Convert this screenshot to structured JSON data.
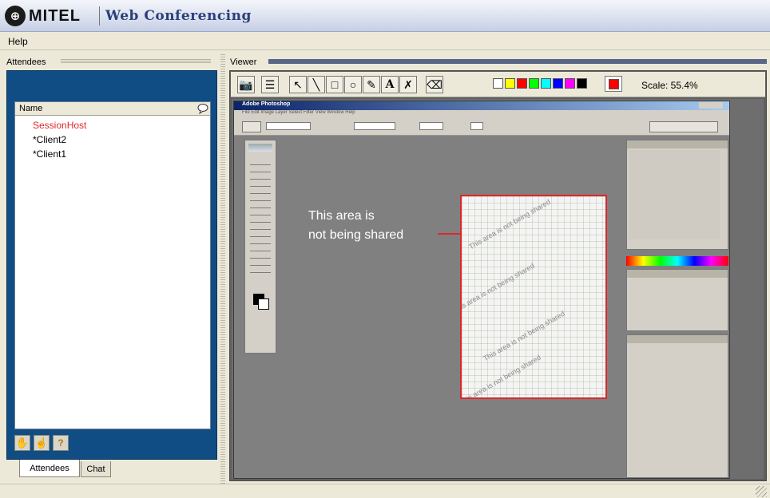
{
  "app": {
    "brand": "MITEL",
    "title": "Web Conferencing"
  },
  "menu": {
    "help": "Help"
  },
  "attendees_pane": {
    "title": "Attendees",
    "column_name": "Name",
    "list": [
      {
        "name": "SessionHost",
        "color": "#e0262b"
      },
      {
        "name": "*Client2",
        "color": "#000000"
      },
      {
        "name": "*Client1",
        "color": "#000000"
      }
    ],
    "tabs": [
      "Attendees",
      "Chat"
    ]
  },
  "viewer": {
    "title": "Viewer",
    "scale_text": "Scale: 55.4%",
    "palette": [
      "#ffffff",
      "#ffff00",
      "#ff0000",
      "#00ff00",
      "#00ffff",
      "#0000ff",
      "#ff00ff",
      "#000000"
    ],
    "active_color": "#ff0000",
    "tools": [
      "camera-icon",
      "line-weight-icon",
      "pointer-icon",
      "line-icon",
      "rectangle-icon",
      "ellipse-icon",
      "highlighter-icon",
      "text-icon",
      "eraser-icon",
      "clear-icon"
    ]
  },
  "shared_app": {
    "window_title": "Adobe Photoshop",
    "menu_text": "File  Edit  Image  Layer  Select  Filter  View  Window  Help",
    "callout_line1": "This area is",
    "callout_line2": "not being shared",
    "watermark": "This area is not being shared"
  }
}
